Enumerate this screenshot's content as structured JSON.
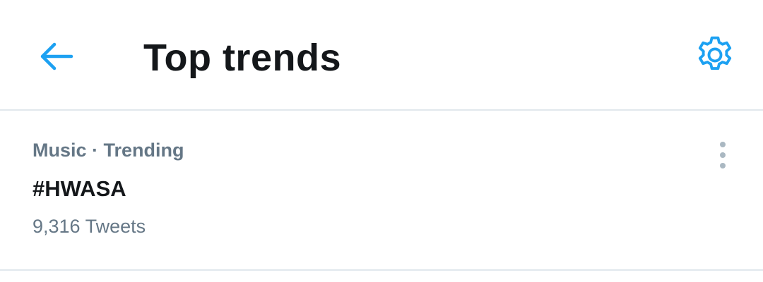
{
  "colors": {
    "accent": "#1da1f2",
    "text_primary": "#14171a",
    "text_secondary": "#657786",
    "divider": "#e1e8ed",
    "more_dots": "#aab8c2"
  },
  "header": {
    "title": "Top trends",
    "back_icon": "arrow-left-icon",
    "settings_icon": "gear-icon"
  },
  "trends": [
    {
      "context": "Music · Trending",
      "name": "#HWASA",
      "count": "9,316 Tweets",
      "more_icon": "more-vertical-icon"
    }
  ]
}
